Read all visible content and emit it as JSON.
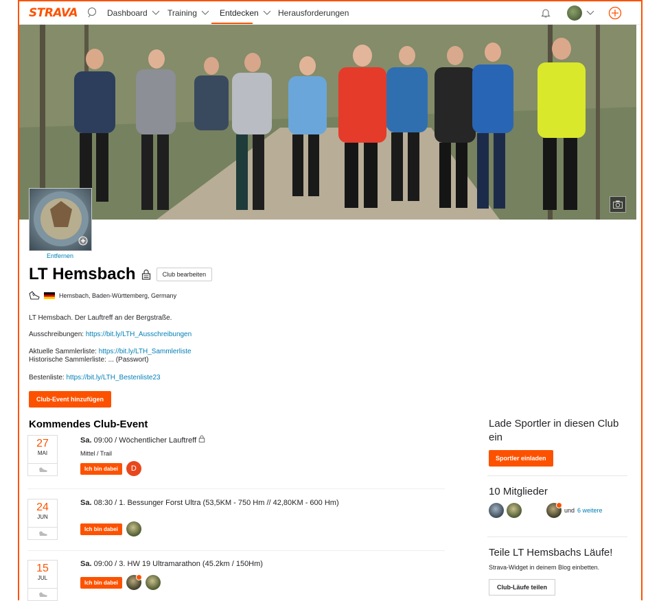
{
  "nav": {
    "logo": "STRAVA",
    "items": [
      "Dashboard",
      "Training",
      "Entdecken",
      "Herausforderungen"
    ],
    "active": "Entdecken"
  },
  "club": {
    "remove_label": "Entfernen",
    "name": "LT Hemsbach",
    "edit_label": "Club bearbeiten",
    "location": "Hemsbach, Baden-Württemberg, Germany",
    "description": "LT Hemsbach. Der Lauftreff an der Bergstraße.",
    "links": [
      {
        "label": "Ausschreibungen:",
        "url": "https://bit.ly/LTH_Ausschreibungen"
      },
      {
        "label": "Aktuelle Sammlerliste:",
        "url": "https://bit.ly/LTH_Sammlerliste"
      },
      {
        "label": "Bestenliste:",
        "url": "https://bit.ly/LTH_Bestenliste23"
      }
    ],
    "historic": "Historische Sammlerliste: ... (Passwort)",
    "add_event_label": "Club-Event hinzufügen"
  },
  "events_section": {
    "title": "Kommendes Club-Event",
    "rsvp_label": "Ich bin dabei",
    "events": [
      {
        "day": "27",
        "month": "MAI",
        "weekday": "Sa.",
        "title": "09:00 / Wöchentlicher Lauftreff",
        "sub": "Mittel / Trail",
        "avatar_letter": "D"
      },
      {
        "day": "24",
        "month": "JUN",
        "weekday": "Sa.",
        "title": "08:30 / 1. Bessunger Forst Ultra (53,5KM - 750 Hm // 42,80KM - 600 Hm)"
      },
      {
        "day": "15",
        "month": "JUL",
        "weekday": "Sa.",
        "title": "09:00 / 3. HW 19 Ultramarathon (45.2km / 150Hm)"
      }
    ]
  },
  "sidebar": {
    "invite_title": "Lade Sportler in diesen Club ein",
    "invite_button": "Sportler einladen",
    "members_title": "10 Mitglieder",
    "members_more_prefix": "und",
    "members_more_link": "6 weitere",
    "share_title": "Teile LT Hemsbachs Läufe!",
    "share_sub": "Strava-Widget in deinem Blog einbetten.",
    "share_button": "Club-Läufe teilen"
  },
  "colors": {
    "brand": "#fc5200",
    "link": "#007fb6"
  }
}
